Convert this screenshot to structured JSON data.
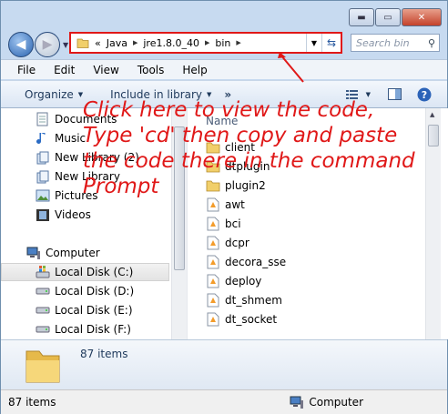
{
  "window": {
    "caption_buttons": {
      "minimize": "▬",
      "maximize": "▭",
      "close": "✕"
    }
  },
  "address_bar": {
    "overflow": "«",
    "crumbs": [
      "Java",
      "jre1.8.0_40",
      "bin"
    ],
    "refresh_icon": "refresh-icon"
  },
  "search": {
    "placeholder": "Search bin"
  },
  "menu": [
    "File",
    "Edit",
    "View",
    "Tools",
    "Help"
  ],
  "command_bar": {
    "organize": "Organize",
    "include_in_library": "Include in library",
    "more": "»"
  },
  "sidebar": {
    "items": [
      {
        "label": "Documents",
        "icon": "documents-icon"
      },
      {
        "label": "Music",
        "icon": "music-icon"
      },
      {
        "label": "New Library (2)",
        "icon": "library-icon"
      },
      {
        "label": "New Library",
        "icon": "library-icon"
      },
      {
        "label": "Pictures",
        "icon": "pictures-icon"
      },
      {
        "label": "Videos",
        "icon": "videos-icon"
      },
      {
        "label": "Computer",
        "icon": "computer-icon"
      },
      {
        "label": "Local Disk (C:)",
        "icon": "windows-drive-icon",
        "selected": true
      },
      {
        "label": "Local Disk (D:)",
        "icon": "drive-icon"
      },
      {
        "label": "Local Disk (E:)",
        "icon": "drive-icon"
      },
      {
        "label": "Local Disk (F:)",
        "icon": "drive-icon"
      }
    ]
  },
  "file_list": {
    "column_header": "Name",
    "files": [
      {
        "name": "client",
        "type": "folder"
      },
      {
        "name": "dtplugin",
        "type": "folder"
      },
      {
        "name": "plugin2",
        "type": "folder"
      },
      {
        "name": "awt",
        "type": "dll"
      },
      {
        "name": "bci",
        "type": "dll"
      },
      {
        "name": "dcpr",
        "type": "dll"
      },
      {
        "name": "decora_sse",
        "type": "dll"
      },
      {
        "name": "deploy",
        "type": "dll"
      },
      {
        "name": "dt_shmem",
        "type": "dll"
      },
      {
        "name": "dt_socket",
        "type": "dll"
      }
    ]
  },
  "details_pane": {
    "item_count": "87 items"
  },
  "status_bar": {
    "item_count": "87 items",
    "location": "Computer"
  },
  "annotation": {
    "lines": [
      "Click here to view the code,",
      "Type 'cd' then copy and paste",
      "the code there in the command",
      "Prompt"
    ],
    "color": "#e01818"
  }
}
